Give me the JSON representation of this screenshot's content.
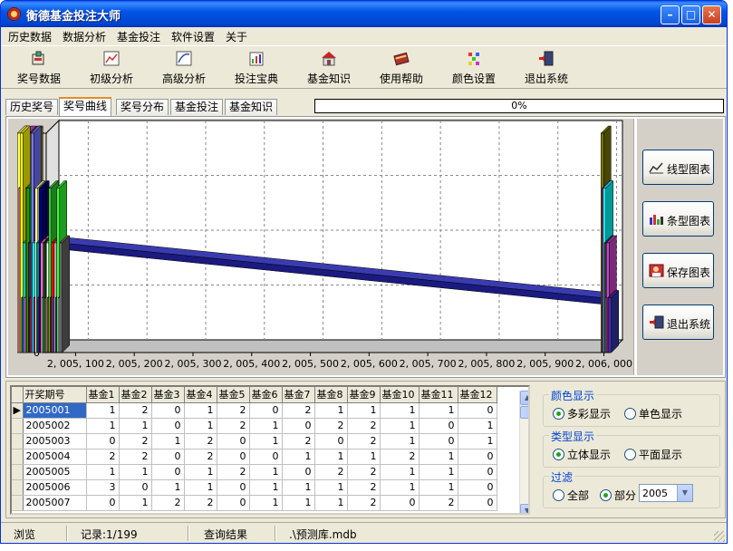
{
  "window": {
    "title": "衡德基金投注大师"
  },
  "menu": [
    "历史数据",
    "数据分析",
    "基金投注",
    "软件设置",
    "关于"
  ],
  "toolbar": [
    {
      "label": "奖号数据",
      "icon": "puzzle-icon"
    },
    {
      "label": "初级分析",
      "icon": "line-chart-icon"
    },
    {
      "label": "高级分析",
      "icon": "curve-chart-icon"
    },
    {
      "label": "投注宝典",
      "icon": "chart-book-icon"
    },
    {
      "label": "基金知识",
      "icon": "house-icon"
    },
    {
      "label": "使用帮助",
      "icon": "help-book-icon"
    },
    {
      "label": "颜色设置",
      "icon": "palette-icon"
    },
    {
      "label": "退出系统",
      "icon": "exit-door-icon"
    }
  ],
  "tabs": [
    "历史奖号",
    "奖号曲线",
    "奖号分布",
    "基金投注",
    "基金知识"
  ],
  "active_tab": 1,
  "progress": {
    "value": 0,
    "text": "0%"
  },
  "chart_data": {
    "type": "bar",
    "title": "",
    "xlabel": "",
    "ylabel": "",
    "ylim": [
      0,
      4
    ],
    "y_ticks": [
      "0",
      "1",
      "2",
      "3",
      "4"
    ],
    "xlim": [
      2005050,
      2006010
    ],
    "x_ticks": [
      "2, 005, 100",
      "2, 005, 200",
      "2, 005, 300",
      "2, 005, 400",
      "2, 005, 500",
      "2, 005, 600",
      "2, 005, 700",
      "2, 005, 800",
      "2, 005, 900",
      "2, 006, 000"
    ],
    "grid": true,
    "left_cluster": {
      "x_range": [
        2005001,
        2005075
      ],
      "values": [
        4,
        3,
        4,
        1,
        2,
        1,
        3,
        3,
        2,
        1,
        4,
        2,
        1,
        3,
        2,
        1,
        3,
        2,
        1,
        2,
        1,
        2,
        1,
        3,
        1,
        2,
        1,
        2,
        1,
        3,
        1,
        2
      ],
      "colors": [
        "#ffff66",
        "#cc33cc",
        "#ffff00",
        "#2222aa",
        "#00cccc",
        "#ff44ff",
        "#888800",
        "#00aa00",
        "#333333",
        "#cc0000",
        "#7777ff",
        "#00ffff",
        "#aa00aa",
        "#ffff99",
        "#008888",
        "#660066",
        "#000088",
        "#ff66cc",
        "#88ff88",
        "#004400",
        "#999999",
        "#ffffff",
        "#cc6600",
        "#33cc33",
        "#444444",
        "#ff0000",
        "#3366ff",
        "#aaaaaa",
        "#333399",
        "#33ff33",
        "#cccccc",
        "#666666"
      ],
      "top_colors": [
        "#ffff99",
        "#cc33cc",
        "#888800"
      ]
    },
    "trend_line": {
      "x": [
        2005075,
        2005995
      ],
      "y": [
        2,
        1
      ],
      "color": "#1a1a80"
    },
    "right_cluster": {
      "x_range": [
        2005995,
        2006012
      ],
      "values": [
        4,
        3,
        3,
        2,
        1,
        2,
        1,
        1
      ],
      "colors": [
        "#777700",
        "#cc33cc",
        "#00ffff",
        "#333333",
        "#888888",
        "#cc44cc",
        "#cc0099",
        "#3333aa"
      ]
    }
  },
  "side_buttons": [
    {
      "label": "线型图表",
      "icon": "line-chart-icon"
    },
    {
      "label": "条型图表",
      "icon": "bar-chart-icon"
    },
    {
      "label": "保存图表",
      "icon": "save-chart-icon"
    },
    {
      "label": "退出系统",
      "icon": "exit-door-icon"
    }
  ],
  "grid": {
    "columns": [
      "开奖期号",
      "基金1",
      "基金2",
      "基金3",
      "基金4",
      "基金5",
      "基金6",
      "基金7",
      "基金8",
      "基金9",
      "基金10",
      "基金11",
      "基金12"
    ],
    "rows": [
      [
        "2005001",
        "1",
        "2",
        "0",
        "1",
        "2",
        "0",
        "2",
        "1",
        "1",
        "1",
        "1",
        "0"
      ],
      [
        "2005002",
        "1",
        "1",
        "0",
        "1",
        "2",
        "1",
        "0",
        "2",
        "2",
        "1",
        "0",
        "1"
      ],
      [
        "2005003",
        "0",
        "2",
        "1",
        "2",
        "0",
        "1",
        "2",
        "0",
        "2",
        "1",
        "0",
        "1"
      ],
      [
        "2005004",
        "2",
        "2",
        "0",
        "2",
        "0",
        "0",
        "1",
        "1",
        "1",
        "2",
        "1",
        "0"
      ],
      [
        "2005005",
        "1",
        "1",
        "0",
        "1",
        "2",
        "1",
        "0",
        "2",
        "2",
        "1",
        "1",
        "0"
      ],
      [
        "2005006",
        "3",
        "0",
        "1",
        "1",
        "0",
        "1",
        "1",
        "1",
        "2",
        "1",
        "1",
        "0"
      ],
      [
        "2005007",
        "0",
        "1",
        "2",
        "2",
        "0",
        "1",
        "1",
        "1",
        "2",
        "0",
        "2",
        "0"
      ]
    ]
  },
  "color_display": {
    "title": "颜色显示",
    "options": [
      "多彩显示",
      "单色显示"
    ],
    "selected": 0
  },
  "type_display": {
    "title": "类型显示",
    "options": [
      "立体显示",
      "平面显示"
    ],
    "selected": 0
  },
  "filter": {
    "title": "过滤",
    "options": [
      "全部",
      "部分"
    ],
    "selected": 1,
    "value": "2005"
  },
  "status": {
    "mode": "浏览",
    "record": "记录:1/199",
    "result": "查询结果",
    "db": ".\\预测库.mdb"
  }
}
